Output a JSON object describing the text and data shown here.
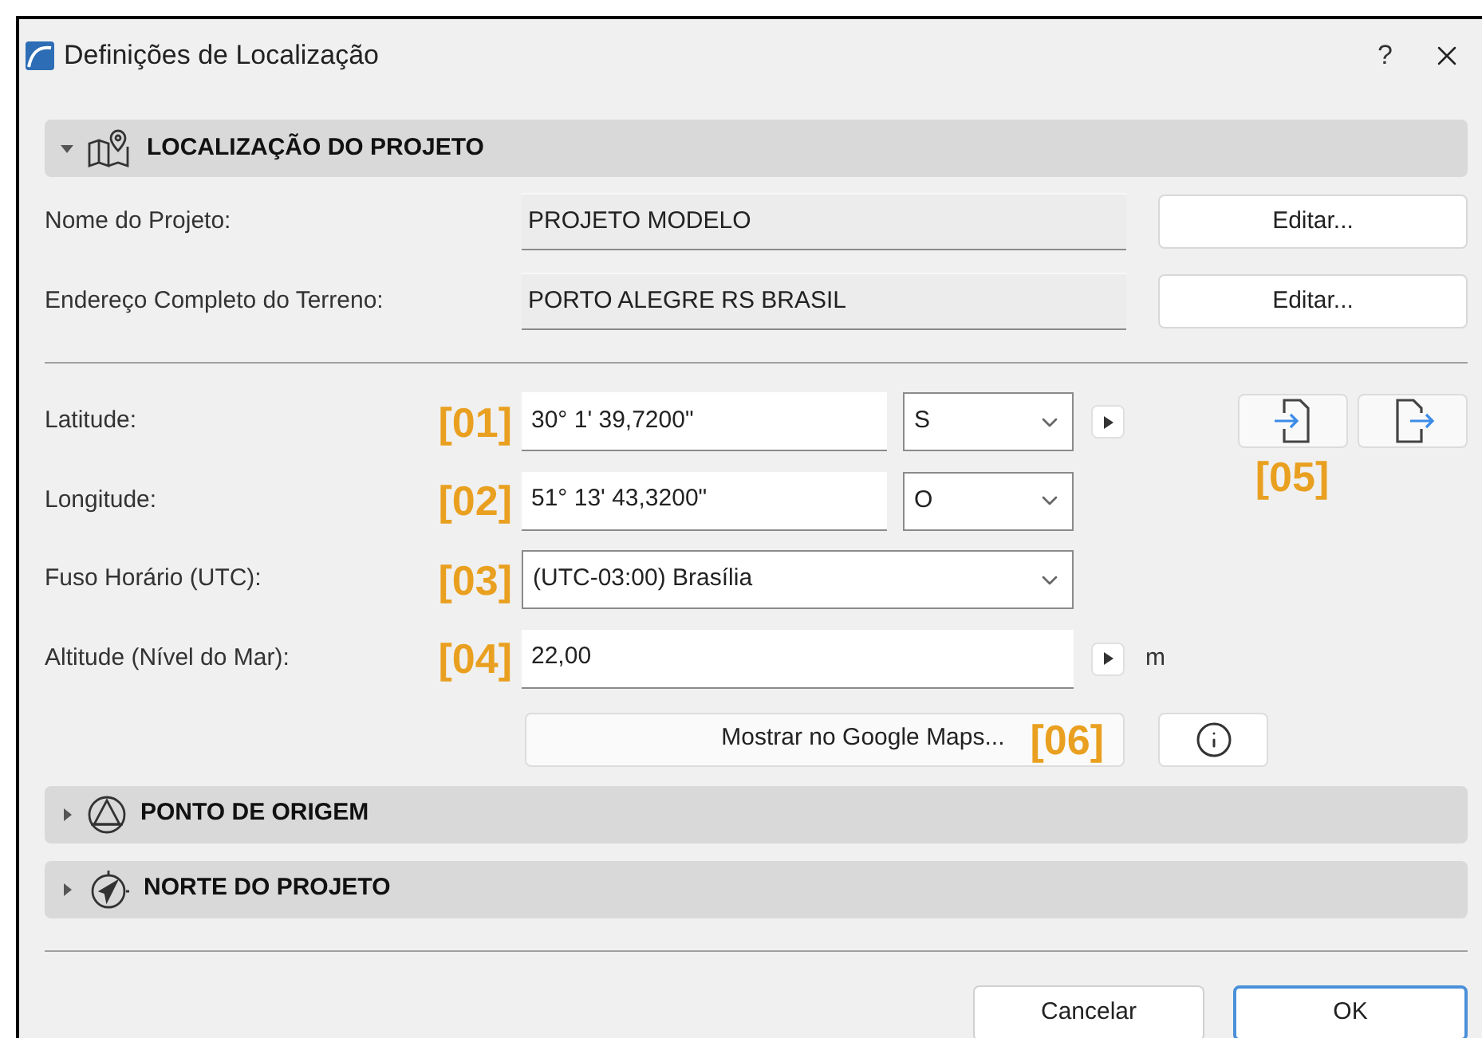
{
  "window": {
    "title": "Definições de Localização",
    "help": "?"
  },
  "sections": [
    {
      "title": "LOCALIZAÇÃO DO PROJETO",
      "expanded": true
    },
    {
      "title": "PONTO DE ORIGEM",
      "expanded": false
    },
    {
      "title": "NORTE DO PROJETO",
      "expanded": false
    }
  ],
  "project_rows": [
    {
      "label": "Nome do Projeto:",
      "value": "PROJETO MODELO",
      "button": "Editar..."
    },
    {
      "label": "Endereço Completo do Terreno:",
      "value": "PORTO ALEGRE RS BRASIL",
      "button": "Editar..."
    }
  ],
  "location_rows": [
    {
      "kind": "coordinate",
      "label": "Latitude:",
      "annotation": "[01]",
      "value": "30° 1' 39,7200\"",
      "direction": "S",
      "stepper": true
    },
    {
      "kind": "coordinate",
      "label": "Longitude:",
      "annotation": "[02]",
      "value": "51° 13' 43,3200\"",
      "direction": "O",
      "stepper": false
    },
    {
      "kind": "select",
      "label": "Fuso Horário (UTC):",
      "annotation": "[03]",
      "value": "(UTC-03:00) Brasília"
    },
    {
      "kind": "number",
      "label": "Altitude (Nível do Mar):",
      "annotation": "[04]",
      "value": "22,00",
      "unit": "m"
    }
  ],
  "file_buttons": {
    "annotation": "[05]"
  },
  "maps_button": {
    "label": "Mostrar no Google Maps...",
    "annotation": "[06]"
  },
  "footer_buttons": [
    {
      "label": "Cancelar",
      "default": false
    },
    {
      "label": "OK",
      "default": true
    }
  ]
}
